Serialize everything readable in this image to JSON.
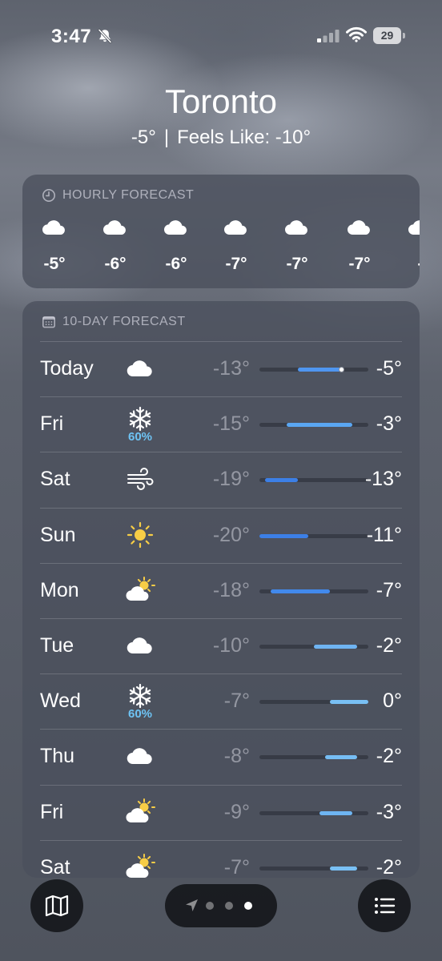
{
  "status_bar": {
    "time": "3:47",
    "battery": "29",
    "icons": [
      "bell-off-icon",
      "cellular-signal-icon",
      "wifi-icon",
      "battery-icon"
    ]
  },
  "location": {
    "city": "Toronto",
    "temperature": "-5°",
    "separator": "|",
    "feels_like": "Feels Like: -10°"
  },
  "hourly": {
    "title": "HOURLY FORECAST",
    "items": [
      {
        "icon": "cloud-icon",
        "temp": "-5°"
      },
      {
        "icon": "cloud-icon",
        "temp": "-6°"
      },
      {
        "icon": "cloud-icon",
        "temp": "-6°"
      },
      {
        "icon": "cloud-icon",
        "temp": "-7°"
      },
      {
        "icon": "cloud-icon",
        "temp": "-7°"
      },
      {
        "icon": "cloud-icon",
        "temp": "-7°"
      },
      {
        "icon": "cloud-icon",
        "temp": "-"
      }
    ]
  },
  "daily": {
    "title": "10-DAY FORECAST",
    "scale_min": -20,
    "scale_max": 0,
    "current_temp": -5,
    "days": [
      {
        "day": "Today",
        "icon": "cloud-icon",
        "precip": "",
        "low": "-13°",
        "high": "-5°",
        "low_value": -13,
        "high_value": -5,
        "color": "#4f96f0"
      },
      {
        "day": "Fri",
        "icon": "snowflake-icon",
        "precip": "60%",
        "low": "-15°",
        "high": "-3°",
        "low_value": -15,
        "high_value": -3,
        "color": "#5aa6f2"
      },
      {
        "day": "Sat",
        "icon": "wind-icon",
        "precip": "",
        "low": "-19°",
        "high": "-13°",
        "low_value": -19,
        "high_value": -13,
        "color": "#3c7fe6"
      },
      {
        "day": "Sun",
        "icon": "sun-icon",
        "precip": "",
        "low": "-20°",
        "high": "-11°",
        "low_value": -20,
        "high_value": -11,
        "color": "#3c7fe6"
      },
      {
        "day": "Mon",
        "icon": "partly-sunny-icon",
        "precip": "",
        "low": "-18°",
        "high": "-7°",
        "low_value": -18,
        "high_value": -7,
        "color": "#4289ec"
      },
      {
        "day": "Tue",
        "icon": "cloud-icon",
        "precip": "",
        "low": "-10°",
        "high": "-2°",
        "low_value": -10,
        "high_value": -2,
        "color": "#6fb4f2"
      },
      {
        "day": "Wed",
        "icon": "snowflake-icon",
        "precip": "60%",
        "low": "-7°",
        "high": "0°",
        "low_value": -7,
        "high_value": 0,
        "color": "#79c0f4"
      },
      {
        "day": "Thu",
        "icon": "cloud-icon",
        "precip": "",
        "low": "-8°",
        "high": "-2°",
        "low_value": -8,
        "high_value": -2,
        "color": "#76bdf4"
      },
      {
        "day": "Fri",
        "icon": "partly-sunny-icon",
        "precip": "",
        "low": "-9°",
        "high": "-3°",
        "low_value": -9,
        "high_value": -3,
        "color": "#6eb5f2"
      },
      {
        "day": "Sat",
        "icon": "partly-sunny-icon",
        "precip": "",
        "low": "-7°",
        "high": "-2°",
        "low_value": -7,
        "high_value": -2,
        "color": "#79c0f4"
      }
    ]
  },
  "bottom_bar": {
    "map_icon": "map-icon",
    "list_icon": "list-icon",
    "page_count": 3,
    "active_page": 3,
    "location_icon": "location-arrow-icon"
  }
}
